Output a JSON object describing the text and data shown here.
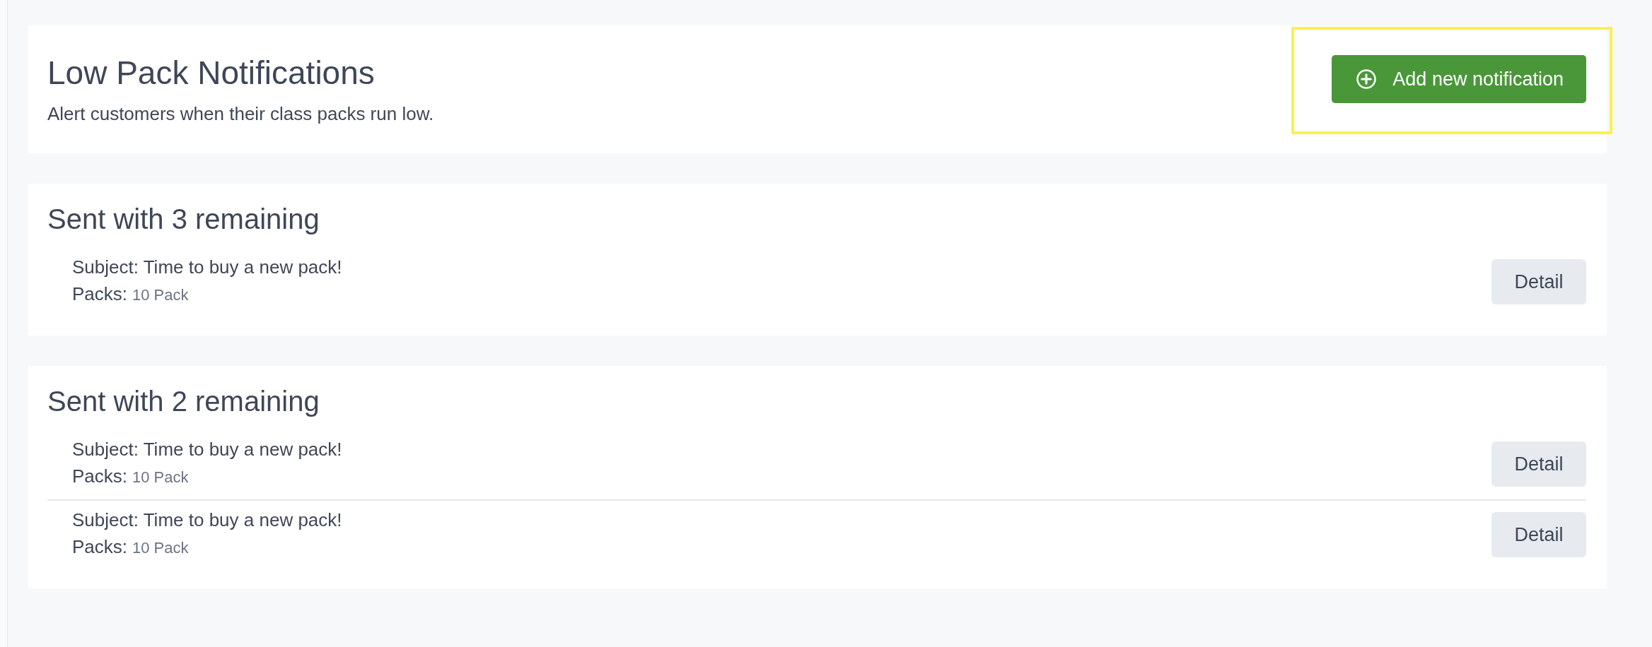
{
  "header": {
    "title": "Low Pack Notifications",
    "subtitle": "Alert customers when their class packs run low.",
    "add_button": {
      "label": "Add new notification",
      "highlighted": true
    }
  },
  "groups": [
    {
      "heading": "Sent with 3 remaining",
      "items": [
        {
          "subject": "Subject: Time to buy a new pack!",
          "packs_label": "Packs:",
          "packs_value": "10 Pack",
          "button": "Detail"
        }
      ]
    },
    {
      "heading": "Sent with 2 remaining",
      "items": [
        {
          "subject": "Subject: Time to buy a new pack!",
          "packs_label": "Packs:",
          "packs_value": "10 Pack",
          "button": "Detail"
        },
        {
          "subject": "Subject: Time to buy a new pack!",
          "packs_label": "Packs:",
          "packs_value": "10 Pack",
          "button": "Detail"
        }
      ]
    }
  ]
}
